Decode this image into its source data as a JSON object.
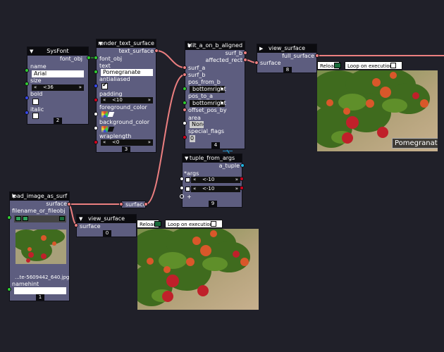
{
  "colors": {
    "background": "#202029",
    "node_body": "#5d5d7f",
    "surface_wire": "#ec7f80",
    "header": "#0b0b0f"
  },
  "sysfont": {
    "title": "SysFont",
    "out_font_obj": "font_obj",
    "name_label": "name",
    "name_value": "Arial",
    "size_label": "size",
    "size_value": "<36",
    "bold_label": "bold",
    "italic_label": "italic",
    "id": "2"
  },
  "render": {
    "title": "render_text_surface",
    "out_label": "text_surface",
    "font_obj_label": "font_obj",
    "text_label": "text",
    "text_value": "Pomegranate",
    "antialiased_label": "antialiased",
    "padding_label": "padding",
    "padding_value": "<10",
    "fg_label": "foreground_color",
    "bg_label": "background_color",
    "wrap_label": "wraplength",
    "wrap_value": "<0",
    "id": "3"
  },
  "blit": {
    "title": "blit_a_on_b_aligned",
    "out_surf_b": "surf_b",
    "out_affected": "affected_rect",
    "surf_a": "surf_a",
    "surf_b": "surf_b",
    "pos_from_b_label": "pos_from_b",
    "pos_from_b_value": "bottomright",
    "pos_to_a_label": "pos_to_a",
    "pos_to_a_value": "bottomright",
    "offset_label": "offset_pos_by",
    "area_label": "area",
    "area_value": "None",
    "flags_label": "special_flags",
    "flags_value": "0",
    "id": "4"
  },
  "view_top": {
    "title": "view_surface",
    "out_label": "full_surface",
    "in_label": "surface",
    "id": "8",
    "reload": "Reload",
    "loop": "Loop on execution",
    "caption": "Pomegranate"
  },
  "tuple": {
    "title": "tuple_from_args",
    "out_label": "a_tuple",
    "args_label": "*args",
    "arg1": "<-10",
    "arg2": "<-10",
    "plus": "+",
    "id": "9"
  },
  "load": {
    "title": "load_image_as_surf",
    "out_label": "surface",
    "file_label": "filename_or_fileobj",
    "file_value": "...te-5609442_640.jpg",
    "namehint_label": "namehint",
    "id": "1"
  },
  "reroute": {
    "label": "surface"
  },
  "view_bottom": {
    "title": "view_surface",
    "in_label": "surface",
    "id": "0",
    "reload": "Reload",
    "loop": "Loop on execution"
  }
}
